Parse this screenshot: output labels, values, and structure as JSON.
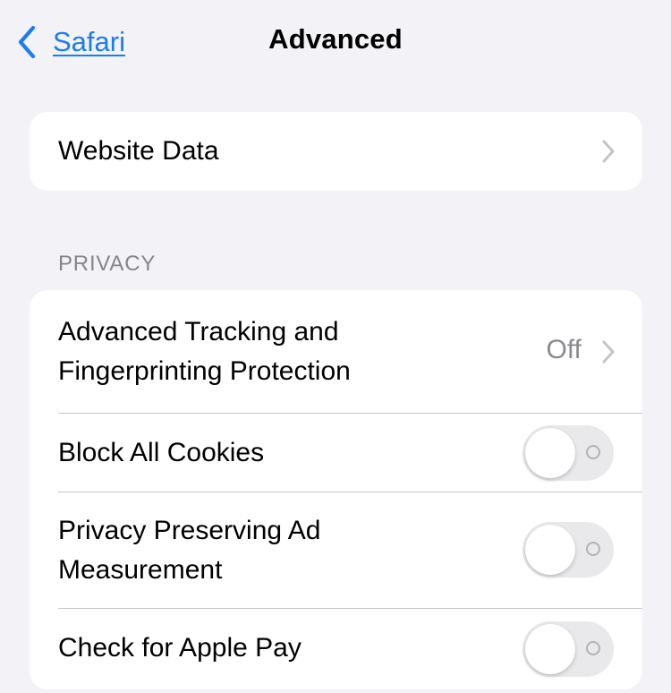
{
  "nav": {
    "back_label": "Safari",
    "title": "Advanced"
  },
  "website_data": {
    "label": "Website Data"
  },
  "privacy": {
    "header": "PRIVACY",
    "tracking": {
      "label_line1": "Advanced Tracking and",
      "label_line2": "Fingerprinting Protection",
      "value": "Off"
    },
    "block_cookies": {
      "label": "Block All Cookies",
      "enabled": false
    },
    "ad_measurement": {
      "label_line1": "Privacy Preserving Ad",
      "label_line2": "Measurement",
      "enabled": false
    },
    "apple_pay": {
      "label": "Check for Apple Pay",
      "enabled": false
    }
  },
  "colors": {
    "accent": "#1a7cf5",
    "background": "#f2f2f7",
    "toggle_off": "#e9e9eb"
  }
}
